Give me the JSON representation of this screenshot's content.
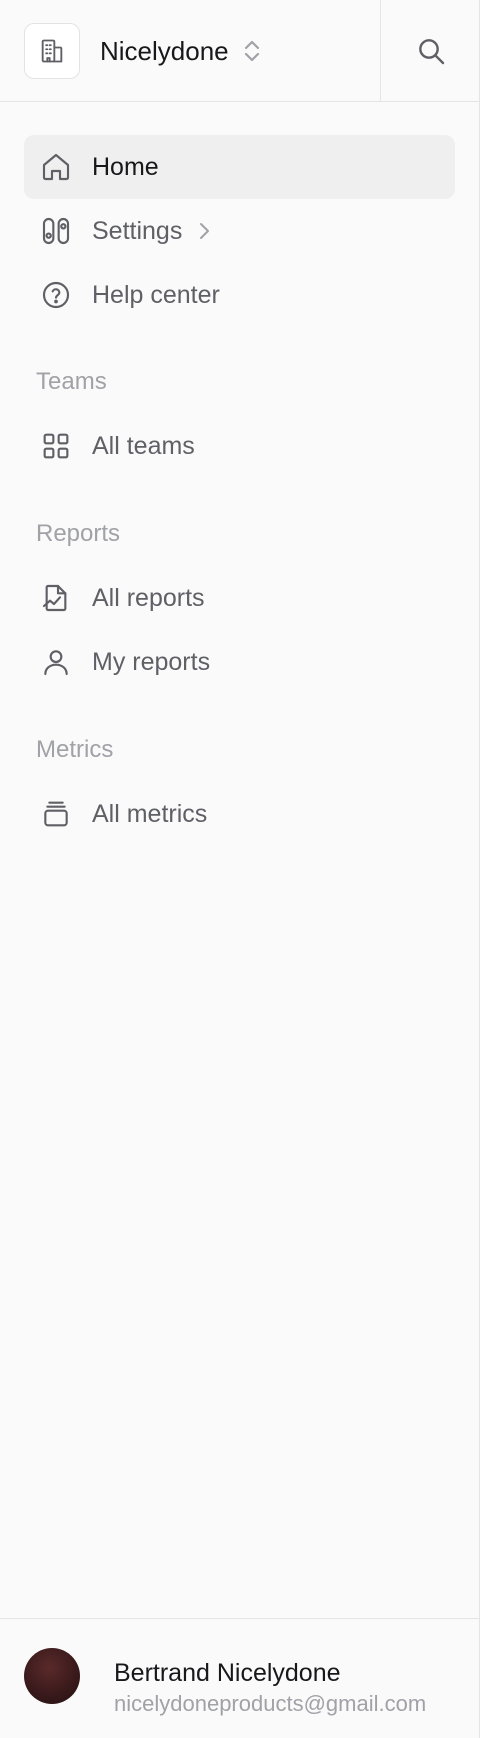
{
  "org": {
    "name": "Nicelydone"
  },
  "nav": {
    "home": "Home",
    "settings": "Settings",
    "help": "Help center"
  },
  "sections": {
    "teams": {
      "title": "Teams",
      "all_teams": "All teams"
    },
    "reports": {
      "title": "Reports",
      "all_reports": "All reports",
      "my_reports": "My reports"
    },
    "metrics": {
      "title": "Metrics",
      "all_metrics": "All metrics"
    }
  },
  "user": {
    "name": "Bertrand Nicelydone",
    "email": "nicelydoneproducts@gmail.com"
  },
  "colors": {
    "active_bg": "#efefef",
    "text_primary": "#18181b",
    "text_secondary": "#5f5f66",
    "section_title": "#a1a1a8"
  },
  "icons": {
    "org": "building-icon",
    "switcher": "chevron-up-down-icon",
    "search": "search-icon",
    "home": "home-icon",
    "settings": "toggles-icon",
    "help": "help-circle-icon",
    "teams": "grid-icon",
    "all_reports": "report-chart-icon",
    "my_reports": "user-icon",
    "metrics": "stack-icon"
  }
}
